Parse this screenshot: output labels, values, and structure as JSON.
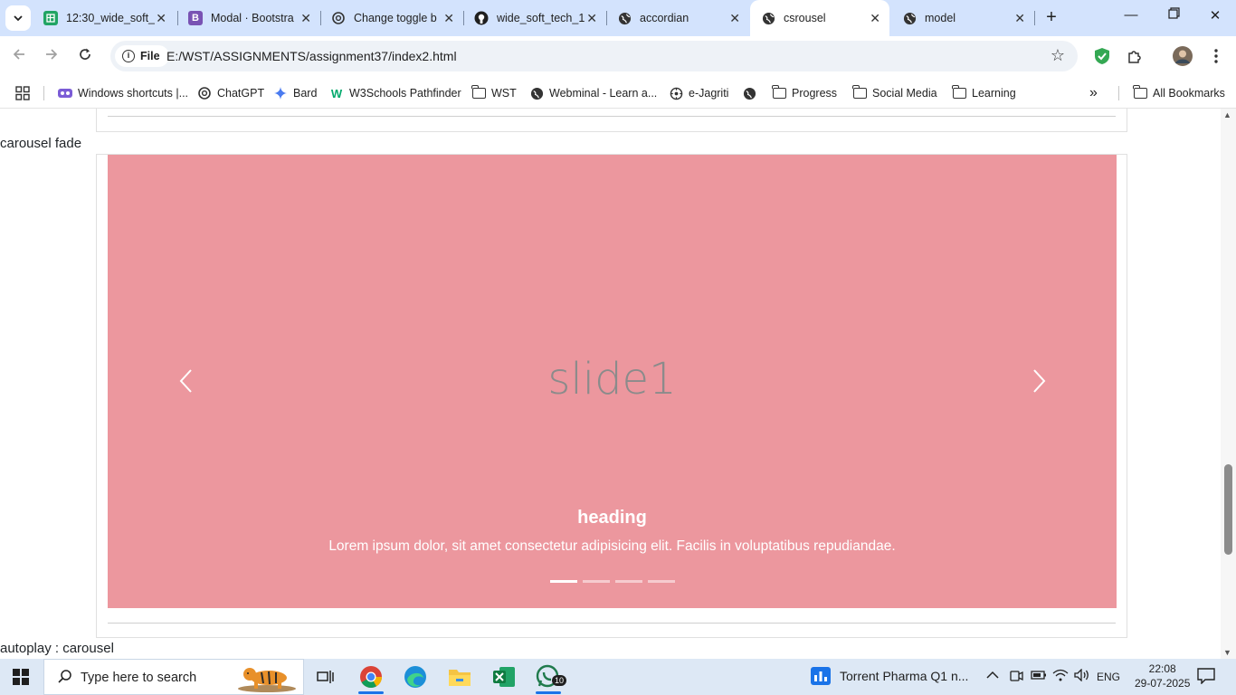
{
  "browser": {
    "tabs": [
      {
        "title": "12:30_wide_soft_",
        "icon": "google-sheets-icon",
        "color": "#21a464",
        "glyph": ""
      },
      {
        "title": "Modal · Bootstra",
        "icon": "bootstrap-icon",
        "color": "#7952b3",
        "glyph": "B"
      },
      {
        "title": "Change toggle b",
        "icon": "chatgpt-icon",
        "color": "#333333",
        "glyph": ""
      },
      {
        "title": "wide_soft_tech_1",
        "icon": "github-icon",
        "color": "#1f1f1f",
        "glyph": ""
      },
      {
        "title": "accordian",
        "icon": "globe-icon",
        "color": "#333333",
        "glyph": ""
      },
      {
        "title": "csrousel",
        "icon": "globe-icon",
        "color": "#333333",
        "glyph": ""
      },
      {
        "title": "model",
        "icon": "globe-icon",
        "color": "#333333",
        "glyph": ""
      }
    ],
    "active_tab_index": 5,
    "address": {
      "scheme_chip": "File",
      "url": "E:/WST/ASSIGNMENTS/assignment37/index2.html"
    },
    "bookmarks": [
      {
        "label": "Windows shortcuts |...",
        "icon": "windows-shortcuts-icon"
      },
      {
        "label": "ChatGPT",
        "icon": "chatgpt-icon"
      },
      {
        "label": "Bard",
        "icon": "bard-icon"
      },
      {
        "label": "W3Schools Pathfinder",
        "icon": "w3schools-icon"
      },
      {
        "label": "WST",
        "icon": "folder-icon"
      },
      {
        "label": "Webminal - Learn a...",
        "icon": "globe-icon"
      },
      {
        "label": "e-Jagriti",
        "icon": "ejagriti-icon"
      },
      {
        "label": "",
        "icon": "globe-icon"
      },
      {
        "label": "Progress",
        "icon": "folder-icon"
      },
      {
        "label": "Social Media",
        "icon": "folder-icon"
      },
      {
        "label": "Learning",
        "icon": "folder-icon"
      }
    ],
    "all_bookmarks": "All Bookmarks",
    "overflow": "»"
  },
  "page": {
    "section_label": "carousel fade",
    "next_section_label": "autoplay : carousel",
    "carousel": {
      "background": "#ec979e",
      "slide_text": "slide1",
      "caption_heading": "heading",
      "caption_text": "Lorem ipsum dolor, sit amet consectetur adipisicing elit. Facilis in voluptatibus repudiandae.",
      "indicator_count": 4,
      "active_indicator": 0
    }
  },
  "taskbar": {
    "search_placeholder": "Type here to search",
    "apps": [
      {
        "name": "task-view-icon",
        "running": false
      },
      {
        "name": "chrome-icon",
        "running": true
      },
      {
        "name": "edge-icon",
        "running": false
      },
      {
        "name": "file-explorer-icon",
        "running": false
      },
      {
        "name": "excel-icon",
        "running": false
      },
      {
        "name": "whatsapp-icon",
        "running": true,
        "badge": "10"
      }
    ],
    "news": "Torrent Pharma Q1 n...",
    "language": "ENG",
    "time": "22:08",
    "date": "29-07-2025"
  }
}
